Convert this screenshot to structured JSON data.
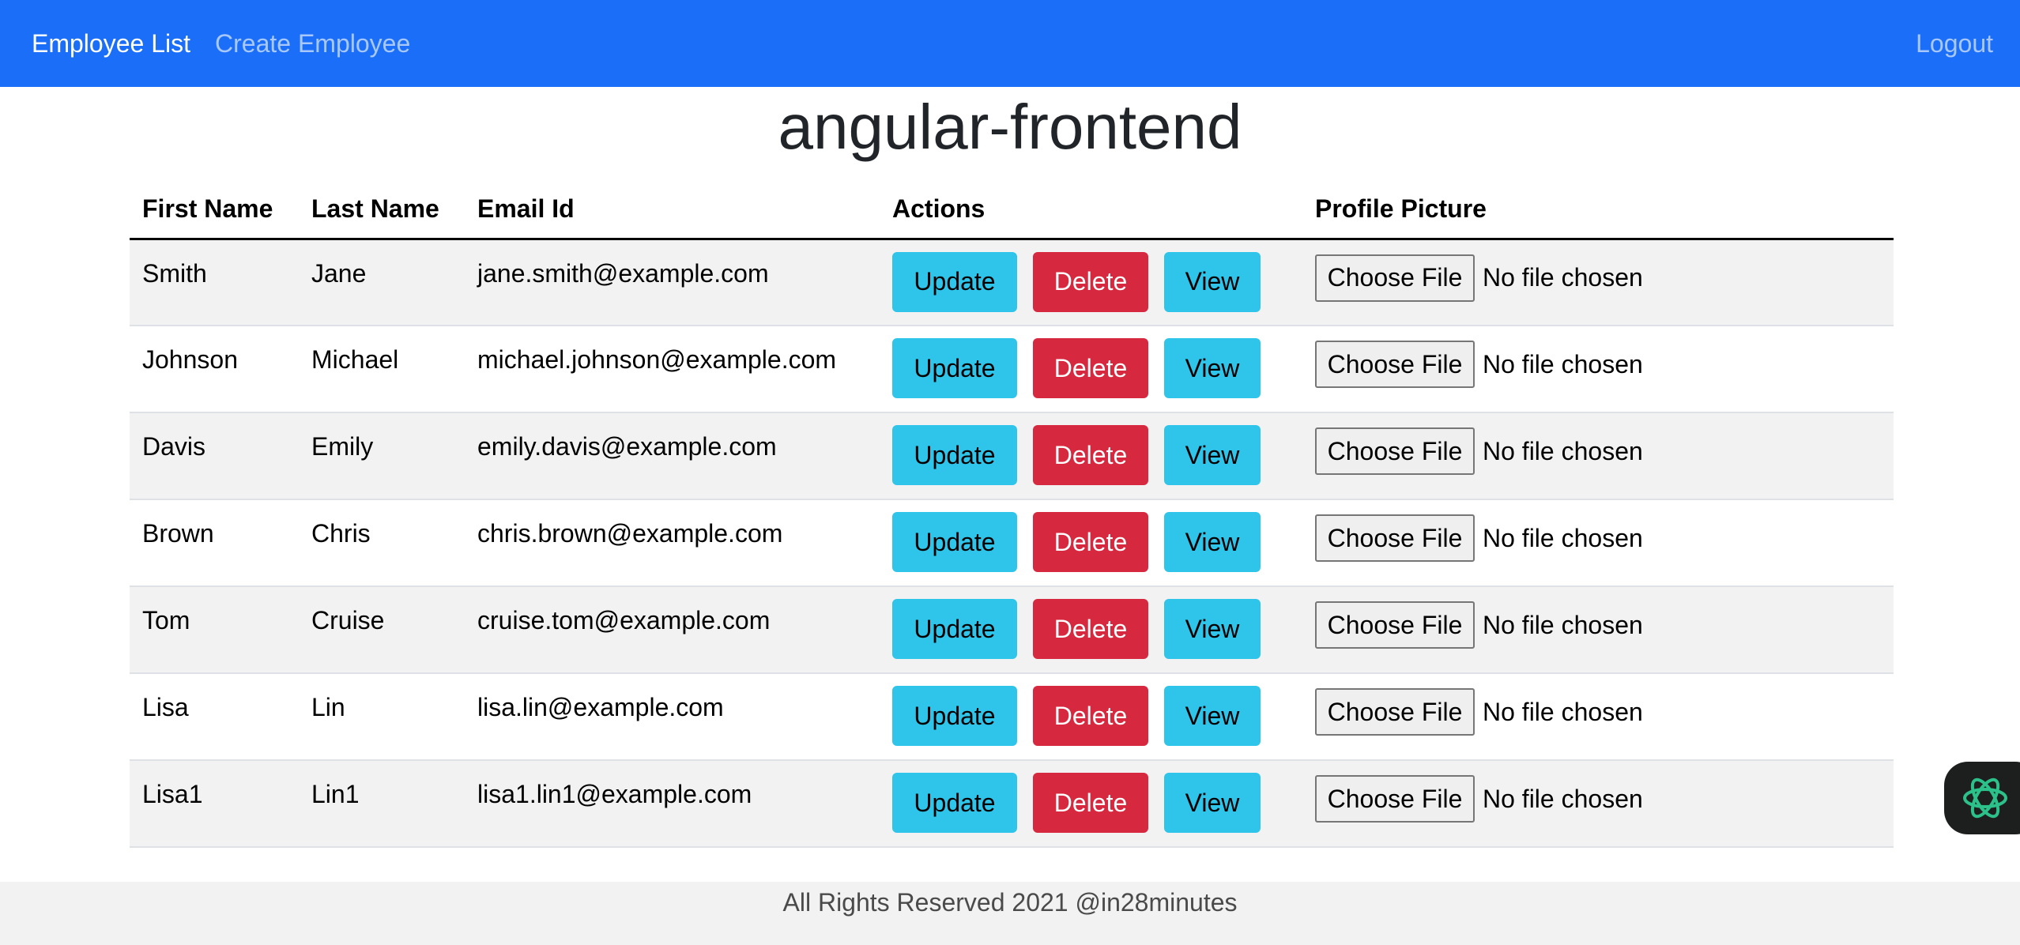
{
  "navbar": {
    "brand_label": "Employee List",
    "create_label": "Create Employee",
    "logout_label": "Logout",
    "background": "#1b6ef7"
  },
  "page": {
    "title": "angular-frontend"
  },
  "table": {
    "headers": [
      "First Name",
      "Last Name",
      "Email Id",
      "Actions",
      "Profile Picture"
    ],
    "rows": [
      {
        "first": "Smith",
        "last": "Jane",
        "email": "jane.smith@example.com"
      },
      {
        "first": "Johnson",
        "last": "Michael",
        "email": "michael.johnson@example.com"
      },
      {
        "first": "Davis",
        "last": "Emily",
        "email": "emily.davis@example.com"
      },
      {
        "first": "Brown",
        "last": "Chris",
        "email": "chris.brown@example.com"
      },
      {
        "first": "Tom",
        "last": "Cruise",
        "email": "cruise.tom@example.com"
      },
      {
        "first": "Lisa",
        "last": "Lin",
        "email": "lisa.lin@example.com"
      },
      {
        "first": "Lisa1",
        "last": "Lin1",
        "email": "lisa1.lin1@example.com"
      }
    ],
    "actions": {
      "update_label": "Update",
      "delete_label": "Delete",
      "view_label": "View"
    },
    "file_input": {
      "button_label": "Choose File",
      "status": "No file chosen"
    }
  },
  "colors": {
    "info": "#2fc4e9",
    "danger": "#d6293f",
    "stripe": "#f2f2f2"
  },
  "footer": {
    "text": "All Rights Reserved 2021 @in28minutes"
  },
  "widget": {
    "icon": "openai-knot-icon"
  }
}
